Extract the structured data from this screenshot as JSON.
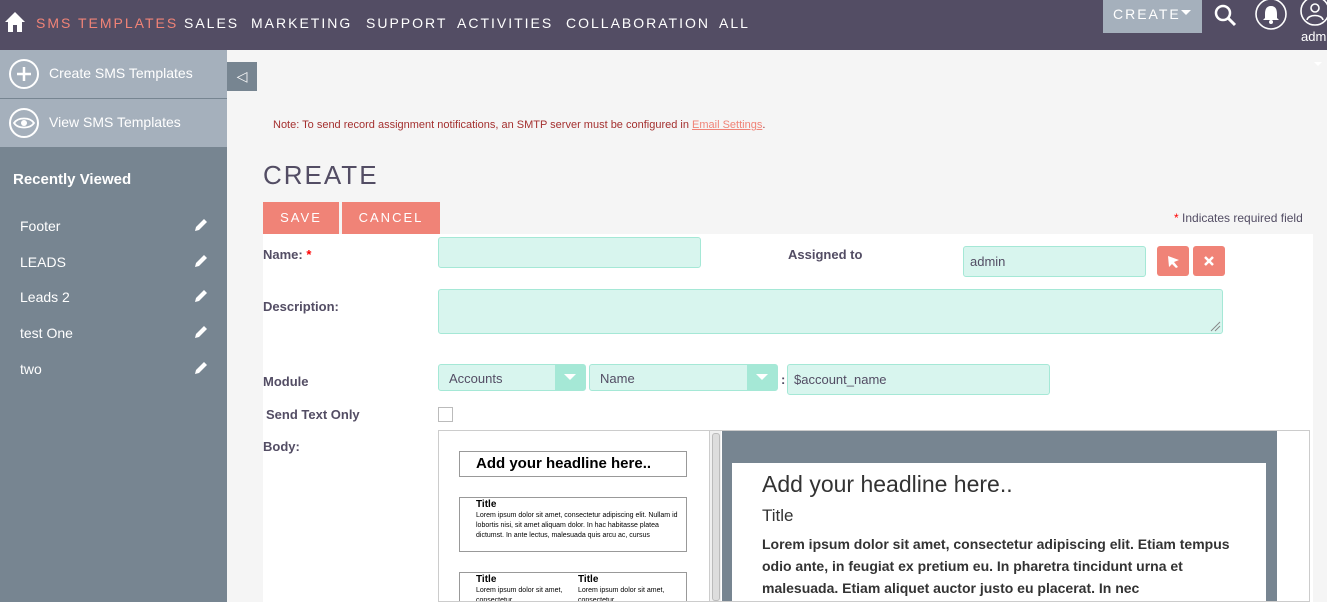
{
  "nav": {
    "module": "SMS TEMPLATES",
    "items": [
      "SALES",
      "MARKETING",
      "SUPPORT",
      "ACTIVITIES",
      "COLLABORATION",
      "ALL"
    ],
    "create_label": "CREATE",
    "user_label": "adm",
    "icons": [
      "home-icon",
      "search-icon",
      "bell-icon",
      "user-icon"
    ]
  },
  "sidebar": {
    "actions": [
      "Create SMS Templates",
      "View SMS Templates"
    ],
    "recent_title": "Recently Viewed",
    "recent_items": [
      "Footer",
      "LEADS",
      "Leads 2",
      "test One",
      "two"
    ]
  },
  "collapse_symbol": "◁",
  "note": {
    "text": "Note: To send record assignment notifications, an SMTP server must be configured in ",
    "link": "Email Settings",
    "end": "."
  },
  "page_title": "CREATE",
  "buttons": {
    "save": "SAVE",
    "cancel": "CANCEL"
  },
  "required_note": {
    "star": "*",
    "text": " Indicates required field"
  },
  "form": {
    "name_label": "Name:",
    "name_value": "",
    "required_star": "*",
    "assigned_label": "Assigned to",
    "assigned_value": "admin",
    "description_label": "Description:",
    "module_label": "Module",
    "module_value": "Accounts",
    "field_value": "Name",
    "separator": ":",
    "variable_value": "$account_name",
    "send_text_label": "Send Text Only",
    "body_label": "Body:"
  },
  "editor": {
    "thumb_headline": "Add your headline here..",
    "thumb_title": "Title",
    "thumb_text": "Lorem ipsum dolor sit amet, consectetur adipiscing elit. Nullam id lobortis nisi, sit amet aliquam dolor. In hac habitasse platea dictumst. In ante lectus, malesuada quis arcu ac, cursus",
    "thumb_col_text": "Lorem ipsum dolor sit amet, consectetur",
    "headline": "Add your headline here..",
    "title": "Title",
    "paragraph": "Lorem ipsum dolor sit amet, consectetur adipiscing elit. Etiam tempus odio ante, in feugiat ex pretium eu. In pharetra tincidunt urna et malesuada. Etiam aliquet auctor justo eu placerat. In nec"
  },
  "colors": {
    "nav_bg": "#534d64",
    "accent": "#f08377",
    "sidebar_bg": "#778591",
    "sidebar_action_bg": "#a5b0bc",
    "input_bg": "#d8f5ee"
  }
}
